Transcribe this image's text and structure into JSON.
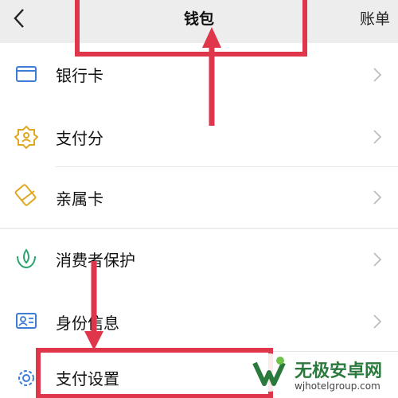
{
  "header": {
    "title": "钱包",
    "right_link": "账单"
  },
  "sections": [
    {
      "items": [
        {
          "label": "银行卡",
          "icon": "bank-card-icon"
        }
      ]
    },
    {
      "items": [
        {
          "label": "支付分",
          "icon": "payscore-icon"
        },
        {
          "label": "亲属卡",
          "icon": "family-card-icon"
        }
      ]
    },
    {
      "items": [
        {
          "label": "消费者保护",
          "icon": "consumer-protection-icon"
        }
      ]
    },
    {
      "items": [
        {
          "label": "身份信息",
          "icon": "id-card-icon"
        },
        {
          "label": "支付设置",
          "icon": "gear-icon"
        }
      ]
    }
  ],
  "colors": {
    "accent_blue": "#3d7dd6",
    "annotation_red": "#e0364c"
  },
  "watermark": {
    "title": "无极安卓网",
    "url": "wjhotelgroup.com"
  }
}
